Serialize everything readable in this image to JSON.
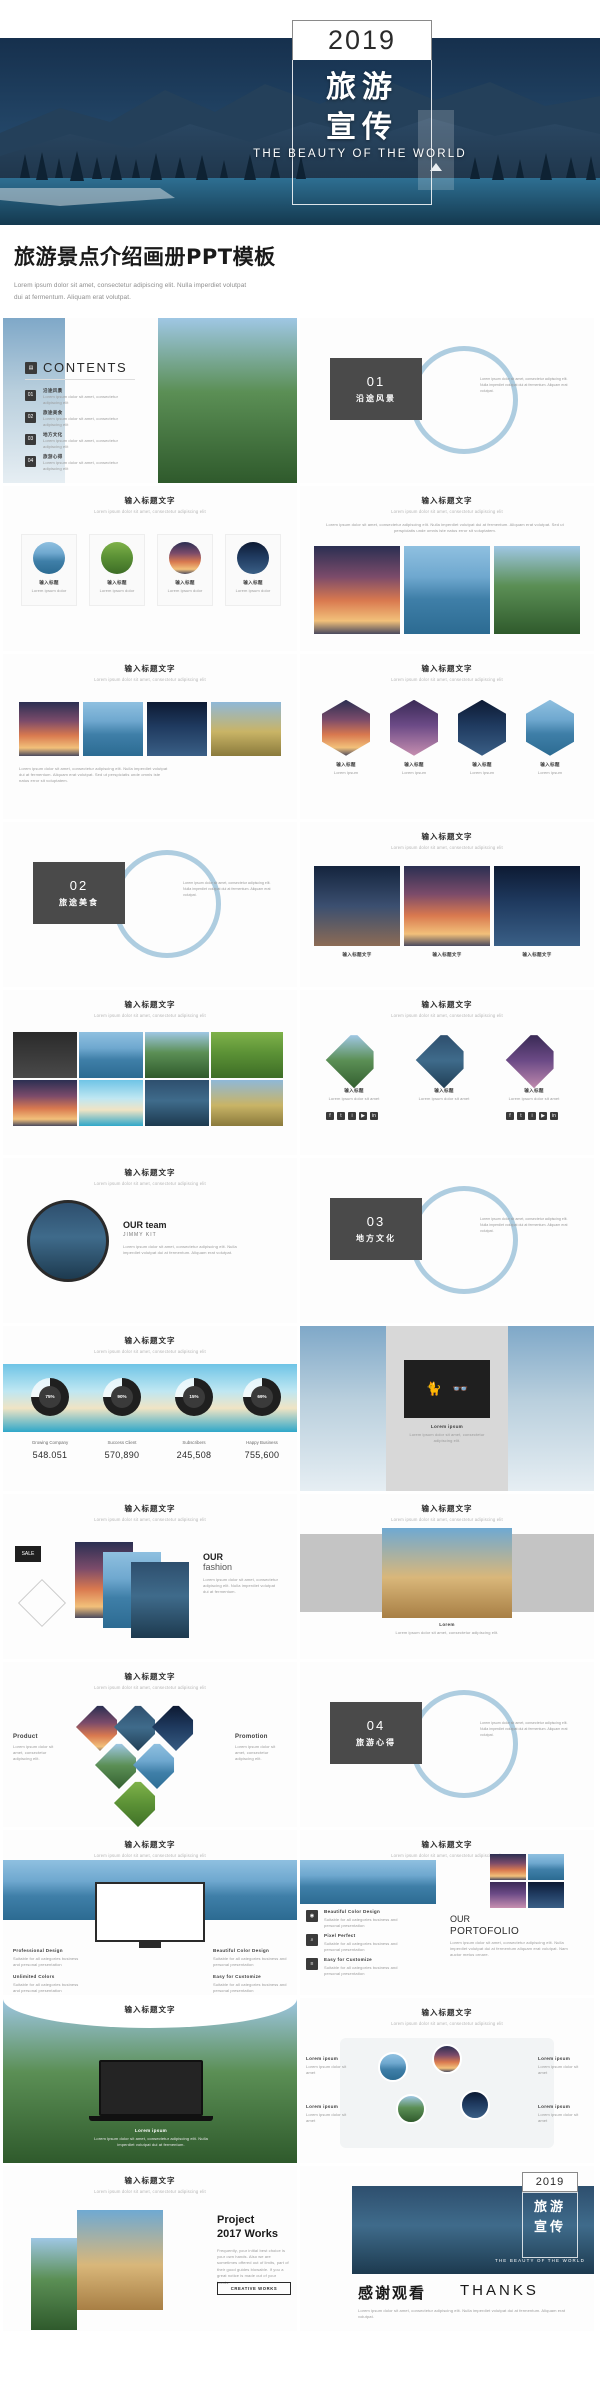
{
  "hero": {
    "year": "2019",
    "cn_line1": "旅游",
    "cn_line2": "宣传",
    "subtitle": "THE BEAUTY OF THE WORLD",
    "arrow_icon": "triangle-up-icon"
  },
  "title_block": {
    "heading": "旅游景点介绍画册PPT模板",
    "description": "Lorem ipsum dolor sit amet, consectetur adipiscing elit. Nulla imperdiet volutpat dui at fermentum. Aliquam erat volutpat."
  },
  "common": {
    "slide_title": "输入标题文字",
    "slide_subtitle": "Lorem ipsum dolor sit amet, consectetur adipiscing elit",
    "lorem_short": "Lorem ipsum dolor sit amet, consectetur adipiscing elit.",
    "lorem_long": "Lorem ipsum dolor sit amet, consectetur adipiscing elit. Nulla imperdiet volutpat dui at fermentum. Aliquam erat volutpat. Sed ut perspiciatis unde omnis iste natus error sit voluptatem.",
    "caption_label": "输入标题文字",
    "caption_sub": "Lorem ipsum dolor sit amet"
  },
  "slides": {
    "contents": {
      "title": "CONTENTS",
      "icon": "book-icon",
      "items": [
        {
          "num": "01",
          "label": "沿途风景",
          "desc": "Lorem ipsum dolor sit amet, consectetur adipiscing elit"
        },
        {
          "num": "02",
          "label": "旅途美食",
          "desc": "Lorem ipsum dolor sit amet, consectetur adipiscing elit"
        },
        {
          "num": "03",
          "label": "地方文化",
          "desc": "Lorem ipsum dolor sit amet, consectetur adipiscing elit"
        },
        {
          "num": "04",
          "label": "旅游心得",
          "desc": "Lorem ipsum dolor sit amet, consectetur adipiscing elit"
        }
      ]
    },
    "sections": [
      {
        "num": "01",
        "label": "沿途风景",
        "desc": "Lorem ipsum dolor sit amet, consectetur adipiscing elit. Nulla imperdiet volutpat dui at fermentum. Aliquam erat volutpat."
      },
      {
        "num": "02",
        "label": "旅途美食",
        "desc": "Lorem ipsum dolor sit amet, consectetur adipiscing elit. Nulla imperdiet volutpat dui at fermentum. Aliquam erat volutpat."
      },
      {
        "num": "03",
        "label": "地方文化",
        "desc": "Lorem ipsum dolor sit amet, consectetur adipiscing elit. Nulla imperdiet volutpat dui at fermentum. Aliquam erat volutpat."
      },
      {
        "num": "04",
        "label": "旅游心得",
        "desc": "Lorem ipsum dolor sit amet, consectetur adipiscing elit. Nulla imperdiet volutpat dui at fermentum. Aliquam erat volutpat."
      }
    ],
    "four_circles": {
      "items": [
        {
          "label": "输入标题",
          "sub": "Lorem ipsum dolor"
        },
        {
          "label": "输入标题",
          "sub": "Lorem ipsum dolor"
        },
        {
          "label": "输入标题",
          "sub": "Lorem ipsum dolor"
        },
        {
          "label": "输入标题",
          "sub": "Lorem ipsum dolor"
        }
      ]
    },
    "hex_row": {
      "items": [
        {
          "label": "输入标题",
          "sub": "Lorem ipsum"
        },
        {
          "label": "输入标题",
          "sub": "Lorem ipsum"
        },
        {
          "label": "输入标题",
          "sub": "Lorem ipsum"
        },
        {
          "label": "输入标题",
          "sub": "Lorem ipsum"
        }
      ]
    },
    "photo_grid_labels": [
      "输入标题文字",
      "输入标题文字",
      "输入标题文字",
      "输入标题文字",
      "输入标题文字",
      "输入标题文字"
    ],
    "diamond_social": {
      "items": [
        {
          "label": "输入标题",
          "sub": "Lorem ipsum dolor sit amet"
        },
        {
          "label": "输入标题",
          "sub": "Lorem ipsum dolor sit amet"
        },
        {
          "label": "输入标题",
          "sub": "Lorem ipsum dolor sit amet"
        }
      ],
      "social_icons": [
        "facebook-icon",
        "twitter-icon",
        "instagram-icon",
        "youtube-icon",
        "linkedin-icon"
      ]
    },
    "team": {
      "title": "OUR team",
      "subtitle": "JIMMY KIT",
      "desc": "Lorem ipsum dolor sit amet, consectetur adipiscing elit. Nulla imperdiet volutpat dui at fermentum. Aliquam erat volutpat."
    },
    "stats": {
      "items": [
        {
          "percent": "75%",
          "label": "Growing Company",
          "value": "548.051"
        },
        {
          "percent": "90%",
          "label": "Success Client",
          "value": "570,890"
        },
        {
          "percent": "15%",
          "label": "Subscribers",
          "value": "245,508"
        },
        {
          "percent": "69%",
          "label": "Happy Business",
          "value": "755,600"
        }
      ]
    },
    "cube": {
      "label": "Lorem ipsum",
      "desc": "Lorem ipsum dolor sit amet, consectetur adipiscing elit.",
      "icons": [
        "cat-icon",
        "glasses-icon"
      ]
    },
    "fashion": {
      "title": "OUR",
      "subtitle": "fashion",
      "badge": "SALE",
      "desc": "Lorem ipsum dolor sit amet, consectetur adipiscing elit. Nulla imperdiet volutpat dui at fermentum."
    },
    "colosseum": {
      "label": "Lorem",
      "desc": "Lorem ipsum dolor sit amet, consectetur adipiscing elit."
    },
    "product_promotion": {
      "left_title": "Product",
      "right_title": "Promotion",
      "left_desc": "Lorem ipsum dolor sit amet, consectetur adipiscing elit.",
      "right_desc": "Lorem ipsum dolor sit amet, consectetur adipiscing elit."
    },
    "device_mockup": {
      "features": [
        {
          "label": "Professional Design",
          "desc": "Suitable for all categories business and personal presentation"
        },
        {
          "label": "Unlimited Colors",
          "desc": "Suitable for all categories business and personal presentation"
        },
        {
          "label": "Beautiful Color Design",
          "desc": "Suitable for all categories business and personal presentation"
        },
        {
          "label": "Easy for Customize",
          "desc": "Suitable for all categories business and personal presentation"
        }
      ]
    },
    "portfolio": {
      "title_line1": "OUR",
      "title_line2": "PORTOFOLIO",
      "desc": "Lorem ipsum dolor sit amet, consectetur adipiscing elit. Nulla imperdiet volutpat dui at fermentum aliquam erat volutpat. Nam auctor metus ornare.",
      "features": [
        {
          "label": "Beautiful Color Design",
          "desc": "Suitable for all categories business and personal presentation",
          "icon": "bulb-icon"
        },
        {
          "label": "Pixel Perfect",
          "desc": "Suitable for all categories business and personal presentation",
          "icon": "search-icon"
        },
        {
          "label": "Easy for Customize",
          "desc": "Suitable for all categories business and personal presentation",
          "icon": "sliders-icon"
        }
      ]
    },
    "laptop": {
      "label": "Lorem ipsum",
      "desc": "Lorem ipsum dolor sit amet, consectetur adipiscing elit. Nulla imperdiet volutpat dui at fermentum."
    },
    "circles_map": {
      "items": [
        {
          "label": "Lorem ipsum",
          "desc": "Lorem ipsum dolor sit amet"
        },
        {
          "label": "Lorem ipsum",
          "desc": "Lorem ipsum dolor sit amet"
        },
        {
          "label": "Lorem ipsum",
          "desc": "Lorem ipsum dolor sit amet"
        },
        {
          "label": "Lorem ipsum",
          "desc": "Lorem ipsum dolor sit amet"
        }
      ]
    },
    "project": {
      "title_line1": "Project",
      "title_line2": "2017 Works",
      "desc": "Frequently, your initial best choice is your own hands. Also we are sometimes offered out of limits, part of their good guides blowable. If you a great notice is made out of your hands.",
      "button": "CREATIVE WORKS"
    },
    "thanks": {
      "year": "2019",
      "cn_line1": "旅游",
      "cn_line2": "宣传",
      "subtitle": "THE BEAUTY OF THE WORLD",
      "cn_thanks": "感谢观看",
      "en_thanks": "THANKS",
      "desc": "Lorem ipsum dolor sit amet, consectetur adipiscing elit. Nulla imperdiet volutpat dui at fermentum. Aliquam erat volutpat."
    }
  }
}
